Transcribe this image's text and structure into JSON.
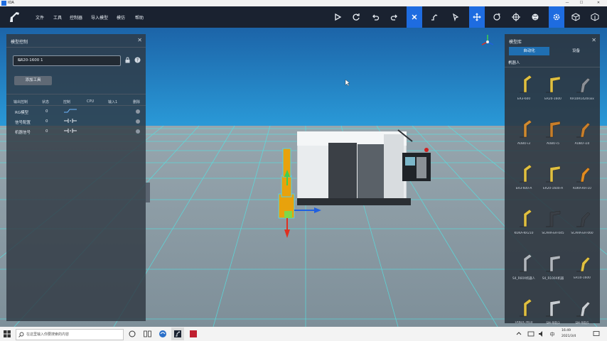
{
  "window": {
    "title": "IOA"
  },
  "menu": {
    "items": [
      "文件",
      "工具",
      "控制器",
      "导入模型",
      "模仿",
      "帮助"
    ]
  },
  "left_panel": {
    "title": "模型控制",
    "robot_select_value": "ER20-1600 1",
    "add_tool_label": "添加工具",
    "columns": [
      "输出控制",
      "状态",
      "控制",
      "CPU",
      "输入1",
      "删除"
    ],
    "rows": [
      {
        "label": "RG模型",
        "value": "0"
      },
      {
        "label": "信号配置",
        "value": "0"
      },
      {
        "label": "机器信号",
        "value": "0"
      }
    ]
  },
  "right_panel": {
    "title": "模型库",
    "tabs": [
      "自动化",
      "设备"
    ],
    "category": "机器人",
    "items": [
      {
        "label": "ER3-600",
        "color": "#e0c040"
      },
      {
        "label": "ER20-1600",
        "color": "#e0c040"
      },
      {
        "label": "KR10R1420sixx",
        "color": "#8a8f96"
      },
      {
        "label": "AUBO-i3",
        "color": "#d08a30"
      },
      {
        "label": "AUBO-i5",
        "color": "#c87e2a"
      },
      {
        "label": "AUBO-i10",
        "color": "#c87e2a"
      },
      {
        "label": "ER3-600-A",
        "color": "#e0c040"
      },
      {
        "label": "ER20-1600-A",
        "color": "#e0c040"
      },
      {
        "label": "KUKA-KR-10",
        "color": "#e08a20"
      },
      {
        "label": "KUKA-KR210",
        "color": "#e0c040"
      },
      {
        "label": "SCARA-ER-045",
        "color": "#3a3f46"
      },
      {
        "label": "SCARA-ER-060",
        "color": "#3a3f46"
      },
      {
        "label": "S4_R60X机器人",
        "color": "#b0b6bd"
      },
      {
        "label": "S4_R100X机器",
        "color": "#b0b6bd"
      },
      {
        "label": "ER10-1600",
        "color": "#e0c040"
      },
      {
        "label": "FANUC-M10",
        "color": "#e0c040"
      },
      {
        "label": "SM-导轨3",
        "color": "#c8cdd2"
      },
      {
        "label": "SM-导轨5",
        "color": "#c8cdd2"
      }
    ]
  },
  "taskbar": {
    "search_placeholder": "在这里输入你要搜索的内容",
    "time": "16:49",
    "date": "2021/3/4"
  },
  "colors": {
    "accent": "#1e6ce0",
    "floor": "#8fa0aa",
    "sky": "#1f6fb2",
    "robot": "#e8a20c"
  }
}
